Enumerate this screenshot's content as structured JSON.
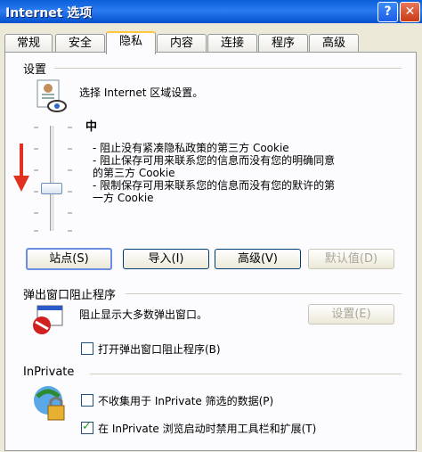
{
  "window": {
    "title": "Internet 选项",
    "help_glyph": "?",
    "close_glyph": "✕"
  },
  "tabs": [
    "常规",
    "安全",
    "隐私",
    "内容",
    "连接",
    "程序",
    "高级"
  ],
  "active_tab": "隐私",
  "settings": {
    "group_title": "设置",
    "zone_prompt": "选择 Internet 区域设置。",
    "level": "中",
    "level_position": "middle",
    "descriptions": [
      "- 阻止没有紧凑隐私政策的第三方 Cookie",
      "- 阻止保存可用来联系您的信息而没有您的明确同意",
      "  的第三方 Cookie",
      "- 限制保存可用来联系您的信息而没有您的默许的第",
      "  一方 Cookie"
    ],
    "buttons": {
      "sites": "站点(S)",
      "import": "导入(I)",
      "advanced": "高级(V)",
      "default": "默认值(D)"
    }
  },
  "popup_blocker": {
    "group_title": "弹出窗口阻止程序",
    "description": "阻止显示大多数弹出窗口。",
    "settings_button": "设置(E)",
    "enable_label": "打开弹出窗口阻止程序(B)",
    "enable_checked": false
  },
  "inprivate": {
    "group_title": "InPrivate",
    "option1_label": "不收集用于 InPrivate 筛选的数据(P)",
    "option1_checked": false,
    "option2_label": "在 InPrivate 浏览启动时禁用工具栏和扩展(T)",
    "option2_checked": true
  },
  "colors": {
    "title_bar": "#0a5fd8",
    "dialog_bg": "#ece9d8",
    "slider_arrow": "#e03020",
    "active_tab_accent": "#ffc83c"
  }
}
